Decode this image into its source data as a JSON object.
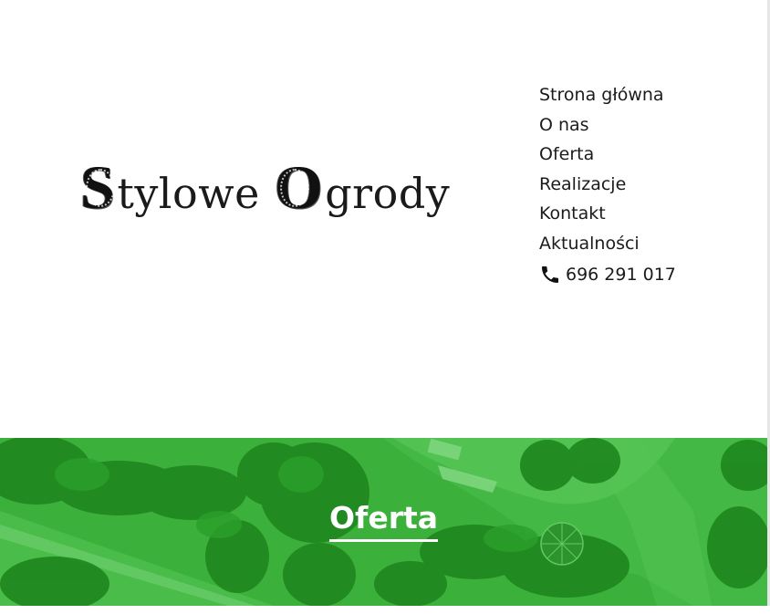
{
  "brand": {
    "logo_initial_1": "S",
    "logo_rest_1": "tylowe",
    "logo_initial_2": "O",
    "logo_rest_2": "grody"
  },
  "nav": {
    "items": [
      {
        "label": "Strona główna"
      },
      {
        "label": "O nas"
      },
      {
        "label": "Oferta"
      },
      {
        "label": "Realizacje"
      },
      {
        "label": "Kontakt"
      },
      {
        "label": "Aktualności"
      }
    ],
    "phone": {
      "icon": "phone-icon",
      "number": "696 291 017"
    }
  },
  "hero": {
    "title": "Oferta",
    "tint_color": "#2fbf2f"
  }
}
